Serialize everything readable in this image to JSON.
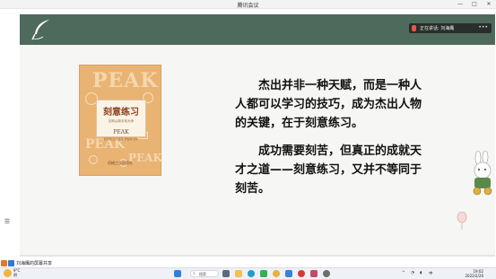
{
  "window": {
    "title": "腾讯会议",
    "controls": [
      "—",
      "□",
      "✕"
    ]
  },
  "notification": {
    "text": "正在讲话: 刘海鹰",
    "more": "•••"
  },
  "book": {
    "big_word": "PEAK",
    "title_cn": "刻意练习",
    "subtitle_cn": "如何从新手到大师",
    "title_en": "PEAK",
    "authors": "安德斯·艾利克森 罗伯特·普尔",
    "publisher": "机械工业出版社"
  },
  "quote": {
    "paragraph1": [
      "杰出并非一种天赋，而是一种人",
      "人都可以学习的技巧，成为杰出人物",
      "的关键，在于刻意练习。"
    ],
    "paragraph2": [
      "成功需要刻苦，但真正的成就天",
      "才之道——刻意练习，又并不等同于",
      "刻苦。"
    ]
  },
  "share_bar": {
    "text": "刘海鹰的屏幕共享"
  },
  "taskbar": {
    "temperature": "9°C",
    "weather": "阴",
    "search_label": "搜索",
    "time": "19:02",
    "date": "2022/2/26",
    "lang": "中",
    "icons": [
      "start-icon",
      "search-icon",
      "taskview-icon",
      "explorer-icon",
      "edge-icon",
      "wechat-icon",
      "chrome-icon",
      "mail-icon",
      "netease-icon",
      "app-icon",
      "meeting-icon"
    ]
  },
  "side": {
    "menu_glyph": "☰"
  }
}
